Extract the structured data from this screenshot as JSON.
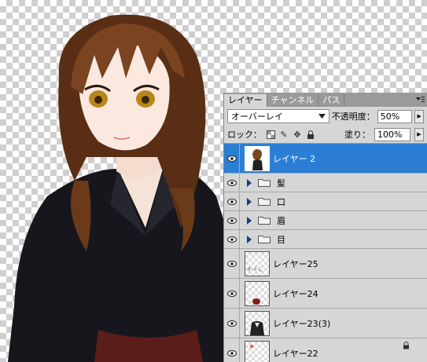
{
  "panel": {
    "tabs": [
      "レイヤー",
      "チャンネル",
      "パス"
    ],
    "blend_mode": "オーバーレイ",
    "opacity_label": "不透明度：",
    "opacity_value": "50%",
    "lock_label": "ロック：",
    "fill_label": "塗り：",
    "fill_value": "100%"
  },
  "layers": [
    {
      "name": "レイヤー 2",
      "type": "layer",
      "selected": true
    },
    {
      "name": "髪",
      "type": "group"
    },
    {
      "name": "口",
      "type": "group"
    },
    {
      "name": "眉",
      "type": "group"
    },
    {
      "name": "目",
      "type": "group"
    },
    {
      "name": "レイヤー25",
      "type": "layer",
      "thumb_text": "オ-トし"
    },
    {
      "name": "レイヤー24",
      "type": "layer"
    },
    {
      "name": "レイヤー23(3)",
      "type": "layer"
    },
    {
      "name": "レイヤー22",
      "type": "layer"
    }
  ],
  "colors": {
    "selection": "#2a7fd4",
    "panel_bg": "#d6d6d6"
  }
}
